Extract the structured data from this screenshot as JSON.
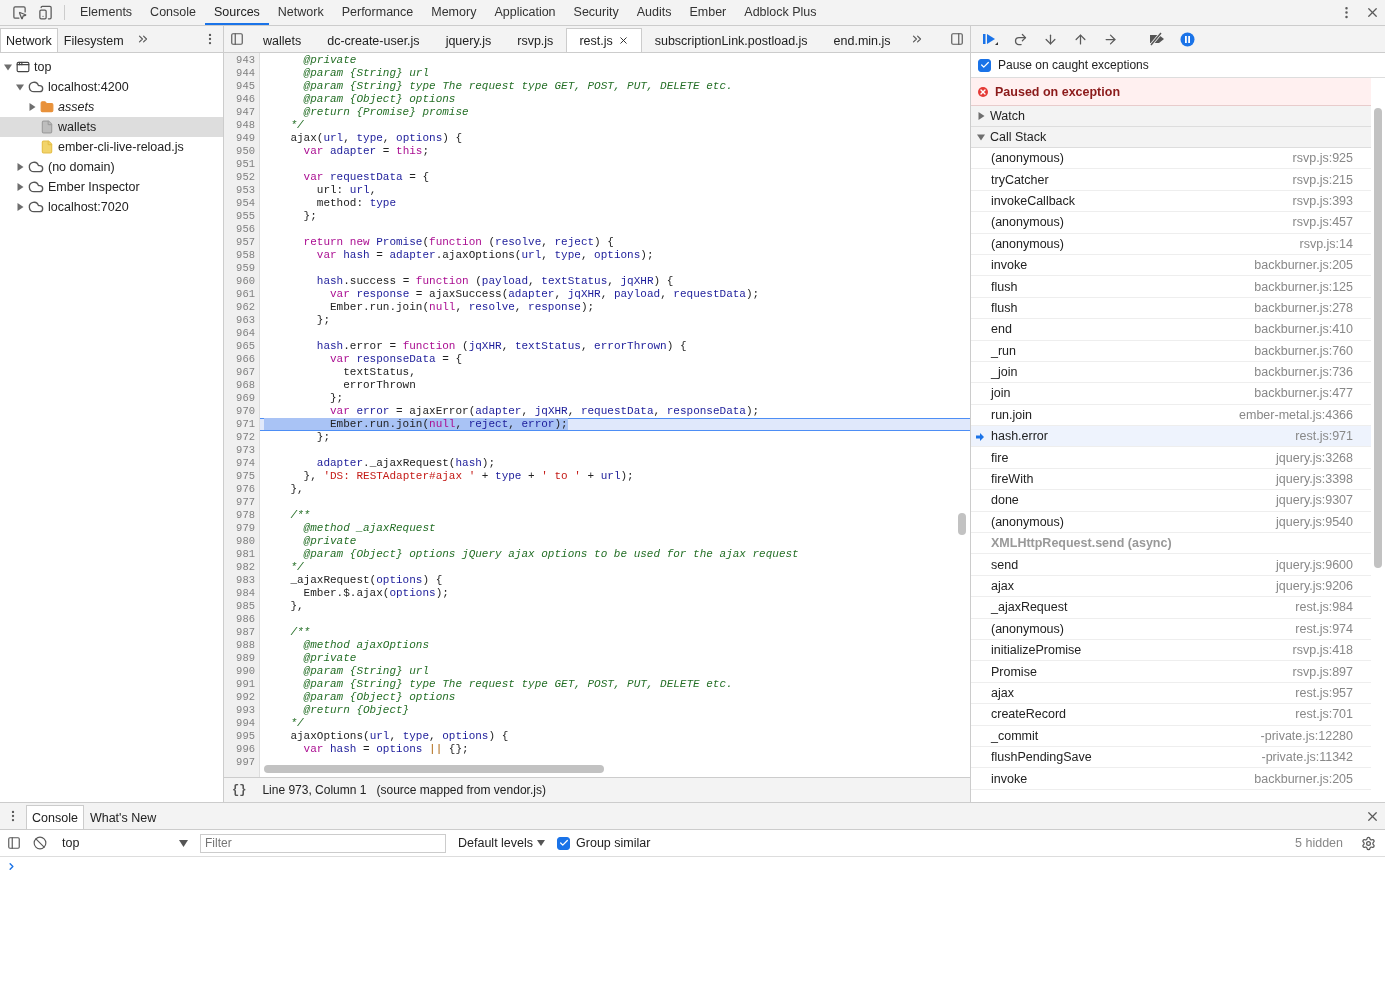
{
  "main_tabs": [
    {
      "label": "Elements",
      "selected": false
    },
    {
      "label": "Console",
      "selected": false
    },
    {
      "label": "Sources",
      "selected": true
    },
    {
      "label": "Network",
      "selected": false
    },
    {
      "label": "Performance",
      "selected": false
    },
    {
      "label": "Memory",
      "selected": false
    },
    {
      "label": "Application",
      "selected": false
    },
    {
      "label": "Security",
      "selected": false
    },
    {
      "label": "Audits",
      "selected": false
    },
    {
      "label": "Ember",
      "selected": false
    },
    {
      "label": "Adblock Plus",
      "selected": false
    }
  ],
  "navigator": {
    "tabs": [
      {
        "label": "Network",
        "selected": true
      },
      {
        "label": "Filesystem",
        "selected": false
      }
    ],
    "tree": [
      {
        "kind": "frame",
        "label": "top",
        "expanded": true,
        "selected": false,
        "children": [
          {
            "kind": "origin",
            "label": "localhost:4200",
            "expanded": true,
            "selected": false,
            "children": [
              {
                "kind": "folder",
                "label": "assets",
                "expanded": false,
                "selected": false
              },
              {
                "kind": "document",
                "label": "wallets",
                "selected": true
              },
              {
                "kind": "script",
                "label": "ember-cli-live-reload.js",
                "selected": false
              }
            ]
          },
          {
            "kind": "origin",
            "label": "(no domain)",
            "expanded": false,
            "selected": false
          },
          {
            "kind": "origin",
            "label": "Ember Inspector",
            "expanded": false,
            "selected": false
          },
          {
            "kind": "origin",
            "label": "localhost:7020",
            "expanded": false,
            "selected": false
          }
        ]
      }
    ]
  },
  "editor": {
    "tabs": [
      {
        "label": "wallets",
        "selected": false
      },
      {
        "label": "dc-create-user.js",
        "selected": false
      },
      {
        "label": "jquery.js",
        "selected": false
      },
      {
        "label": "rsvp.js",
        "selected": false
      },
      {
        "label": "rest.js",
        "selected": true
      },
      {
        "label": "subscriptionLink.postload.js",
        "selected": false
      },
      {
        "label": "end.min.js",
        "selected": false
      }
    ],
    "lines": [
      {
        "n": "943",
        "highlighted": false,
        "t": [
          {
            "kind": "comment",
            "text": "      @private"
          }
        ]
      },
      {
        "n": "944",
        "highlighted": false,
        "t": [
          {
            "kind": "comment",
            "text": "      @param {String} url"
          }
        ]
      },
      {
        "n": "945",
        "highlighted": false,
        "t": [
          {
            "kind": "comment",
            "text": "      @param {String} type The request type GET, POST, PUT, DELETE etc."
          }
        ]
      },
      {
        "n": "946",
        "highlighted": false,
        "t": [
          {
            "kind": "comment",
            "text": "      @param {Object} options"
          }
        ]
      },
      {
        "n": "947",
        "highlighted": false,
        "t": [
          {
            "kind": "comment",
            "text": "      @return {Promise} promise"
          }
        ]
      },
      {
        "n": "948",
        "highlighted": false,
        "t": [
          {
            "kind": "comment",
            "text": "    */"
          }
        ]
      },
      {
        "n": "949",
        "highlighted": false,
        "t": [
          {
            "kind": "plain",
            "text": "    ajax("
          },
          {
            "kind": "variable",
            "text": "url"
          },
          {
            "kind": "plain",
            "text": ", "
          },
          {
            "kind": "variable",
            "text": "type"
          },
          {
            "kind": "plain",
            "text": ", "
          },
          {
            "kind": "variable",
            "text": "options"
          },
          {
            "kind": "plain",
            "text": ") {"
          }
        ]
      },
      {
        "n": "950",
        "highlighted": false,
        "t": [
          {
            "kind": "keyword",
            "text": "      var "
          },
          {
            "kind": "variable",
            "text": "adapter"
          },
          {
            "kind": "plain",
            "text": " = "
          },
          {
            "kind": "keyword",
            "text": "this"
          },
          {
            "kind": "plain",
            "text": ";"
          }
        ]
      },
      {
        "n": "951",
        "highlighted": false
      },
      {
        "n": "952",
        "highlighted": false,
        "t": [
          {
            "kind": "keyword",
            "text": "      var "
          },
          {
            "kind": "variable",
            "text": "requestData"
          },
          {
            "kind": "plain",
            "text": " = {"
          }
        ]
      },
      {
        "n": "953",
        "highlighted": false,
        "t": [
          {
            "kind": "plain",
            "text": "        url: "
          },
          {
            "kind": "variable",
            "text": "url"
          },
          {
            "kind": "plain",
            "text": ","
          }
        ]
      },
      {
        "n": "954",
        "highlighted": false,
        "t": [
          {
            "kind": "plain",
            "text": "        method: "
          },
          {
            "kind": "variable",
            "text": "type"
          }
        ]
      },
      {
        "n": "955",
        "highlighted": false,
        "t": [
          {
            "kind": "plain",
            "text": "      };"
          }
        ]
      },
      {
        "n": "956",
        "highlighted": false
      },
      {
        "n": "957",
        "highlighted": false,
        "t": [
          {
            "kind": "keyword",
            "text": "      return new "
          },
          {
            "kind": "variable",
            "text": "Promise"
          },
          {
            "kind": "plain",
            "text": "("
          },
          {
            "kind": "keyword",
            "text": "function"
          },
          {
            "kind": "plain",
            "text": " ("
          },
          {
            "kind": "variable",
            "text": "resolve"
          },
          {
            "kind": "plain",
            "text": ", "
          },
          {
            "kind": "variable",
            "text": "reject"
          },
          {
            "kind": "plain",
            "text": ") {"
          }
        ]
      },
      {
        "n": "958",
        "highlighted": false,
        "t": [
          {
            "kind": "keyword",
            "text": "        var "
          },
          {
            "kind": "variable",
            "text": "hash"
          },
          {
            "kind": "plain",
            "text": " = "
          },
          {
            "kind": "variable",
            "text": "adapter"
          },
          {
            "kind": "plain",
            "text": ".ajaxOptions("
          },
          {
            "kind": "variable",
            "text": "url"
          },
          {
            "kind": "plain",
            "text": ", "
          },
          {
            "kind": "variable",
            "text": "type"
          },
          {
            "kind": "plain",
            "text": ", "
          },
          {
            "kind": "variable",
            "text": "options"
          },
          {
            "kind": "plain",
            "text": ");"
          }
        ]
      },
      {
        "n": "959",
        "highlighted": false
      },
      {
        "n": "960",
        "highlighted": false,
        "t": [
          {
            "kind": "variable",
            "text": "        hash"
          },
          {
            "kind": "plain",
            "text": ".success = "
          },
          {
            "kind": "keyword",
            "text": "function"
          },
          {
            "kind": "plain",
            "text": " ("
          },
          {
            "kind": "variable",
            "text": "payload"
          },
          {
            "kind": "plain",
            "text": ", "
          },
          {
            "kind": "variable",
            "text": "textStatus"
          },
          {
            "kind": "plain",
            "text": ", "
          },
          {
            "kind": "variable",
            "text": "jqXHR"
          },
          {
            "kind": "plain",
            "text": ") {"
          }
        ]
      },
      {
        "n": "961",
        "highlighted": false,
        "t": [
          {
            "kind": "keyword",
            "text": "          var "
          },
          {
            "kind": "variable",
            "text": "response"
          },
          {
            "kind": "plain",
            "text": " = ajaxSuccess("
          },
          {
            "kind": "variable",
            "text": "adapter"
          },
          {
            "kind": "plain",
            "text": ", "
          },
          {
            "kind": "variable",
            "text": "jqXHR"
          },
          {
            "kind": "plain",
            "text": ", "
          },
          {
            "kind": "variable",
            "text": "payload"
          },
          {
            "kind": "plain",
            "text": ", "
          },
          {
            "kind": "variable",
            "text": "requestData"
          },
          {
            "kind": "plain",
            "text": ");"
          }
        ]
      },
      {
        "n": "962",
        "highlighted": false,
        "t": [
          {
            "kind": "plain",
            "text": "          Ember.run.join("
          },
          {
            "kind": "keyword",
            "text": "null"
          },
          {
            "kind": "plain",
            "text": ", "
          },
          {
            "kind": "variable",
            "text": "resolve"
          },
          {
            "kind": "plain",
            "text": ", "
          },
          {
            "kind": "variable",
            "text": "response"
          },
          {
            "kind": "plain",
            "text": ");"
          }
        ]
      },
      {
        "n": "963",
        "highlighted": false,
        "t": [
          {
            "kind": "plain",
            "text": "        };"
          }
        ]
      },
      {
        "n": "964",
        "highlighted": false
      },
      {
        "n": "965",
        "highlighted": false,
        "t": [
          {
            "kind": "variable",
            "text": "        hash"
          },
          {
            "kind": "plain",
            "text": ".error = "
          },
          {
            "kind": "keyword",
            "text": "function"
          },
          {
            "kind": "plain",
            "text": " ("
          },
          {
            "kind": "variable",
            "text": "jqXHR"
          },
          {
            "kind": "plain",
            "text": ", "
          },
          {
            "kind": "variable",
            "text": "textStatus"
          },
          {
            "kind": "plain",
            "text": ", "
          },
          {
            "kind": "variable",
            "text": "errorThrown"
          },
          {
            "kind": "plain",
            "text": ") {"
          }
        ]
      },
      {
        "n": "966",
        "highlighted": false,
        "t": [
          {
            "kind": "keyword",
            "text": "          var "
          },
          {
            "kind": "variable",
            "text": "responseData"
          },
          {
            "kind": "plain",
            "text": " = {"
          }
        ]
      },
      {
        "n": "967",
        "highlighted": false,
        "t": [
          {
            "kind": "plain",
            "text": "            textStatus,"
          }
        ]
      },
      {
        "n": "968",
        "highlighted": false,
        "t": [
          {
            "kind": "plain",
            "text": "            errorThrown"
          }
        ]
      },
      {
        "n": "969",
        "highlighted": false,
        "t": [
          {
            "kind": "plain",
            "text": "          };"
          }
        ]
      },
      {
        "n": "970",
        "highlighted": false,
        "t": [
          {
            "kind": "keyword",
            "text": "          var "
          },
          {
            "kind": "variable",
            "text": "error"
          },
          {
            "kind": "plain",
            "text": " = ajaxError("
          },
          {
            "kind": "variable",
            "text": "adapter"
          },
          {
            "kind": "plain",
            "text": ", "
          },
          {
            "kind": "variable",
            "text": "jqXHR"
          },
          {
            "kind": "plain",
            "text": ", "
          },
          {
            "kind": "variable",
            "text": "requestData"
          },
          {
            "kind": "plain",
            "text": ", "
          },
          {
            "kind": "variable",
            "text": "responseData"
          },
          {
            "kind": "plain",
            "text": ");"
          }
        ]
      },
      {
        "n": "971",
        "highlighted": true,
        "t": [
          {
            "kind": "plain",
            "text": "          Ember.run.join("
          },
          {
            "kind": "keyword",
            "text": "null"
          },
          {
            "kind": "plain",
            "text": ", "
          },
          {
            "kind": "variable",
            "text": "reject"
          },
          {
            "kind": "plain",
            "text": ", "
          },
          {
            "kind": "variable",
            "text": "error"
          },
          {
            "kind": "plain",
            "text": ");"
          }
        ]
      },
      {
        "n": "972",
        "highlighted": false,
        "t": [
          {
            "kind": "plain",
            "text": "        };"
          }
        ]
      },
      {
        "n": "973",
        "highlighted": false
      },
      {
        "n": "974",
        "highlighted": false,
        "t": [
          {
            "kind": "variable",
            "text": "        adapter"
          },
          {
            "kind": "plain",
            "text": "._ajaxRequest("
          },
          {
            "kind": "variable",
            "text": "hash"
          },
          {
            "kind": "plain",
            "text": ");"
          }
        ]
      },
      {
        "n": "975",
        "highlighted": false,
        "t": [
          {
            "kind": "plain",
            "text": "      }, "
          },
          {
            "kind": "string",
            "text": "'DS: RESTAdapter#ajax '"
          },
          {
            "kind": "plain",
            "text": " + "
          },
          {
            "kind": "variable",
            "text": "type"
          },
          {
            "kind": "plain",
            "text": " + "
          },
          {
            "kind": "string",
            "text": "' to '"
          },
          {
            "kind": "plain",
            "text": " + "
          },
          {
            "kind": "variable",
            "text": "url"
          },
          {
            "kind": "plain",
            "text": ");"
          }
        ]
      },
      {
        "n": "976",
        "highlighted": false,
        "t": [
          {
            "kind": "plain",
            "text": "    },"
          }
        ]
      },
      {
        "n": "977",
        "highlighted": false
      },
      {
        "n": "978",
        "highlighted": false,
        "t": [
          {
            "kind": "comment",
            "text": "    /**"
          }
        ]
      },
      {
        "n": "979",
        "highlighted": false,
        "t": [
          {
            "kind": "comment",
            "text": "      @method _ajaxRequest"
          }
        ]
      },
      {
        "n": "980",
        "highlighted": false,
        "t": [
          {
            "kind": "comment",
            "text": "      @private"
          }
        ]
      },
      {
        "n": "981",
        "highlighted": false,
        "t": [
          {
            "kind": "comment",
            "text": "      @param {Object} options jQuery ajax options to be used for the ajax request"
          }
        ]
      },
      {
        "n": "982",
        "highlighted": false,
        "t": [
          {
            "kind": "comment",
            "text": "    */"
          }
        ]
      },
      {
        "n": "983",
        "highlighted": false,
        "t": [
          {
            "kind": "plain",
            "text": "    _ajaxRequest("
          },
          {
            "kind": "variable",
            "text": "options"
          },
          {
            "kind": "plain",
            "text": ") {"
          }
        ]
      },
      {
        "n": "984",
        "highlighted": false,
        "t": [
          {
            "kind": "plain",
            "text": "      Ember.$.ajax("
          },
          {
            "kind": "variable",
            "text": "options"
          },
          {
            "kind": "plain",
            "text": ");"
          }
        ]
      },
      {
        "n": "985",
        "highlighted": false,
        "t": [
          {
            "kind": "plain",
            "text": "    },"
          }
        ]
      },
      {
        "n": "986",
        "highlighted": false
      },
      {
        "n": "987",
        "highlighted": false,
        "t": [
          {
            "kind": "comment",
            "text": "    /**"
          }
        ]
      },
      {
        "n": "988",
        "highlighted": false,
        "t": [
          {
            "kind": "comment",
            "text": "      @method ajaxOptions"
          }
        ]
      },
      {
        "n": "989",
        "highlighted": false,
        "t": [
          {
            "kind": "comment",
            "text": "      @private"
          }
        ]
      },
      {
        "n": "990",
        "highlighted": false,
        "t": [
          {
            "kind": "comment",
            "text": "      @param {String} url"
          }
        ]
      },
      {
        "n": "991",
        "highlighted": false,
        "t": [
          {
            "kind": "comment",
            "text": "      @param {String} type The request type GET, POST, PUT, DELETE etc."
          }
        ]
      },
      {
        "n": "992",
        "highlighted": false,
        "t": [
          {
            "kind": "comment",
            "text": "      @param {Object} options"
          }
        ]
      },
      {
        "n": "993",
        "highlighted": false,
        "t": [
          {
            "kind": "comment",
            "text": "      @return {Object}"
          }
        ]
      },
      {
        "n": "994",
        "highlighted": false,
        "t": [
          {
            "kind": "comment",
            "text": "    */"
          }
        ]
      },
      {
        "n": "995",
        "highlighted": false,
        "t": [
          {
            "kind": "plain",
            "text": "    ajaxOptions("
          },
          {
            "kind": "variable",
            "text": "url"
          },
          {
            "kind": "plain",
            "text": ", "
          },
          {
            "kind": "variable",
            "text": "type"
          },
          {
            "kind": "plain",
            "text": ", "
          },
          {
            "kind": "variable",
            "text": "options"
          },
          {
            "kind": "plain",
            "text": ") {"
          }
        ]
      },
      {
        "n": "996",
        "highlighted": false,
        "t": [
          {
            "kind": "keyword",
            "text": "      var "
          },
          {
            "kind": "variable",
            "text": "hash"
          },
          {
            "kind": "plain",
            "text": " = "
          },
          {
            "kind": "variable",
            "text": "options"
          },
          {
            "kind": "operator",
            "text": " ||"
          },
          {
            "kind": "plain",
            "text": " {};"
          }
        ]
      },
      {
        "n": "997",
        "highlighted": false
      }
    ],
    "status": {
      "format_button": "{}",
      "position": "Line 973, Column 1",
      "source_note": "(source mapped from vendor.js)"
    }
  },
  "debugger": {
    "pause_on_caught": {
      "label": "Pause on caught exceptions",
      "checked": true
    },
    "banner": "Paused on exception",
    "watch": {
      "label": "Watch",
      "expanded": false
    },
    "call_stack": {
      "label": "Call Stack",
      "expanded": true,
      "frames": [
        {
          "kind": "frame",
          "name": "(anonymous)",
          "location": "rsvp.js:925",
          "selected": false
        },
        {
          "kind": "frame",
          "name": "tryCatcher",
          "location": "rsvp.js:215",
          "selected": false
        },
        {
          "kind": "frame",
          "name": "invokeCallback",
          "location": "rsvp.js:393",
          "selected": false
        },
        {
          "kind": "frame",
          "name": "(anonymous)",
          "location": "rsvp.js:457",
          "selected": false
        },
        {
          "kind": "frame",
          "name": "(anonymous)",
          "location": "rsvp.js:14",
          "selected": false
        },
        {
          "kind": "frame",
          "name": "invoke",
          "location": "backburner.js:205",
          "selected": false
        },
        {
          "kind": "frame",
          "name": "flush",
          "location": "backburner.js:125",
          "selected": false
        },
        {
          "kind": "frame",
          "name": "flush",
          "location": "backburner.js:278",
          "selected": false
        },
        {
          "kind": "frame",
          "name": "end",
          "location": "backburner.js:410",
          "selected": false
        },
        {
          "kind": "frame",
          "name": "_run",
          "location": "backburner.js:760",
          "selected": false
        },
        {
          "kind": "frame",
          "name": "_join",
          "location": "backburner.js:736",
          "selected": false
        },
        {
          "kind": "frame",
          "name": "join",
          "location": "backburner.js:477",
          "selected": false
        },
        {
          "kind": "frame",
          "name": "run.join",
          "location": "ember-metal.js:4366",
          "selected": false
        },
        {
          "kind": "frame",
          "name": "hash.error",
          "location": "rest.js:971",
          "selected": true
        },
        {
          "kind": "frame",
          "name": "fire",
          "location": "jquery.js:3268",
          "selected": false
        },
        {
          "kind": "frame",
          "name": "fireWith",
          "location": "jquery.js:3398",
          "selected": false
        },
        {
          "kind": "frame",
          "name": "done",
          "location": "jquery.js:9307",
          "selected": false
        },
        {
          "kind": "frame",
          "name": "(anonymous)",
          "location": "jquery.js:9540",
          "selected": false
        },
        {
          "kind": "async",
          "name": "XMLHttpRequest.send (async)"
        },
        {
          "kind": "frame",
          "name": "send",
          "location": "jquery.js:9600",
          "selected": false
        },
        {
          "kind": "frame",
          "name": "ajax",
          "location": "jquery.js:9206",
          "selected": false
        },
        {
          "kind": "frame",
          "name": "_ajaxRequest",
          "location": "rest.js:984",
          "selected": false
        },
        {
          "kind": "frame",
          "name": "(anonymous)",
          "location": "rest.js:974",
          "selected": false
        },
        {
          "kind": "frame",
          "name": "initializePromise",
          "location": "rsvp.js:418",
          "selected": false
        },
        {
          "kind": "frame",
          "name": "Promise",
          "location": "rsvp.js:897",
          "selected": false
        },
        {
          "kind": "frame",
          "name": "ajax",
          "location": "rest.js:957",
          "selected": false
        },
        {
          "kind": "frame",
          "name": "createRecord",
          "location": "rest.js:701",
          "selected": false
        },
        {
          "kind": "frame",
          "name": "_commit",
          "location": "-private.js:12280",
          "selected": false
        },
        {
          "kind": "frame",
          "name": "flushPendingSave",
          "location": "-private.js:11342",
          "selected": false
        },
        {
          "kind": "frame",
          "name": "invoke",
          "location": "backburner.js:205",
          "selected": false
        }
      ]
    }
  },
  "drawer": {
    "tabs": [
      {
        "label": "Console",
        "selected": true
      },
      {
        "label": "What's New",
        "selected": false
      }
    ],
    "context": "top",
    "filter": {
      "placeholder": "Filter"
    },
    "levels": "Default levels",
    "group_similar": {
      "label": "Group similar",
      "checked": true
    },
    "hidden_count": "5 hidden"
  }
}
